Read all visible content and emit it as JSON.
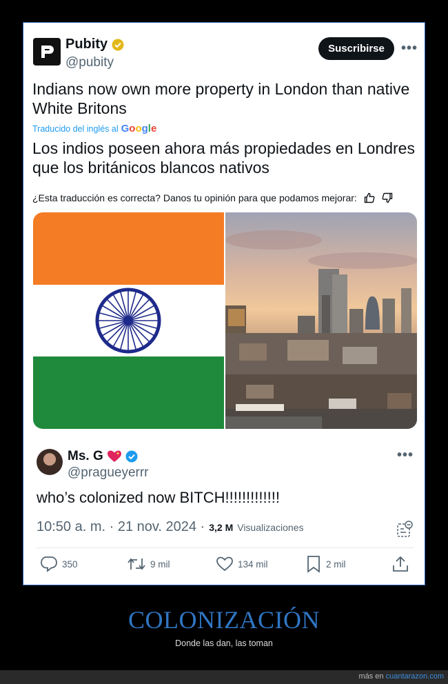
{
  "post": {
    "author_name": "Pubity",
    "author_handle": "@pubity",
    "subscribe_label": "Suscribirse",
    "more": "•••",
    "text": "Indians now own more property in London than native White Britons",
    "translated_by": "Traducido del inglés al",
    "google": "Google",
    "translated_text": "Los indios poseen ahora más propiedades en Londres que los británicos blancos nativos",
    "feedback": "¿Esta traducción es correcta? Danos tu opinión para que podamos mejorar:"
  },
  "quote": {
    "name": "Ms. G",
    "handle": "@pragueyerrr",
    "more": "•••",
    "text": "who’s colonized now BITCH!!!!!!!!!!!!!",
    "time": "10:50 a. m. · 21 nov. 2024 ·",
    "views_count": "3,2 M",
    "views_label": "Visualizaciones"
  },
  "actions": {
    "replies": "350",
    "reposts": "9 mil",
    "likes": "134 mil",
    "bookmarks": "2 mil"
  },
  "footer": {
    "title": "COLONIZACIÓN",
    "subtitle": "Donde las dan, las toman",
    "credit_prefix": "más en",
    "credit_link": "cuantarazon.com"
  },
  "colors": {
    "accent": "#1d9bf0",
    "saffron": "#f47c25",
    "green": "#1f8a3b",
    "chakra": "#1e2a8a",
    "title_blue": "#2f77c5"
  }
}
